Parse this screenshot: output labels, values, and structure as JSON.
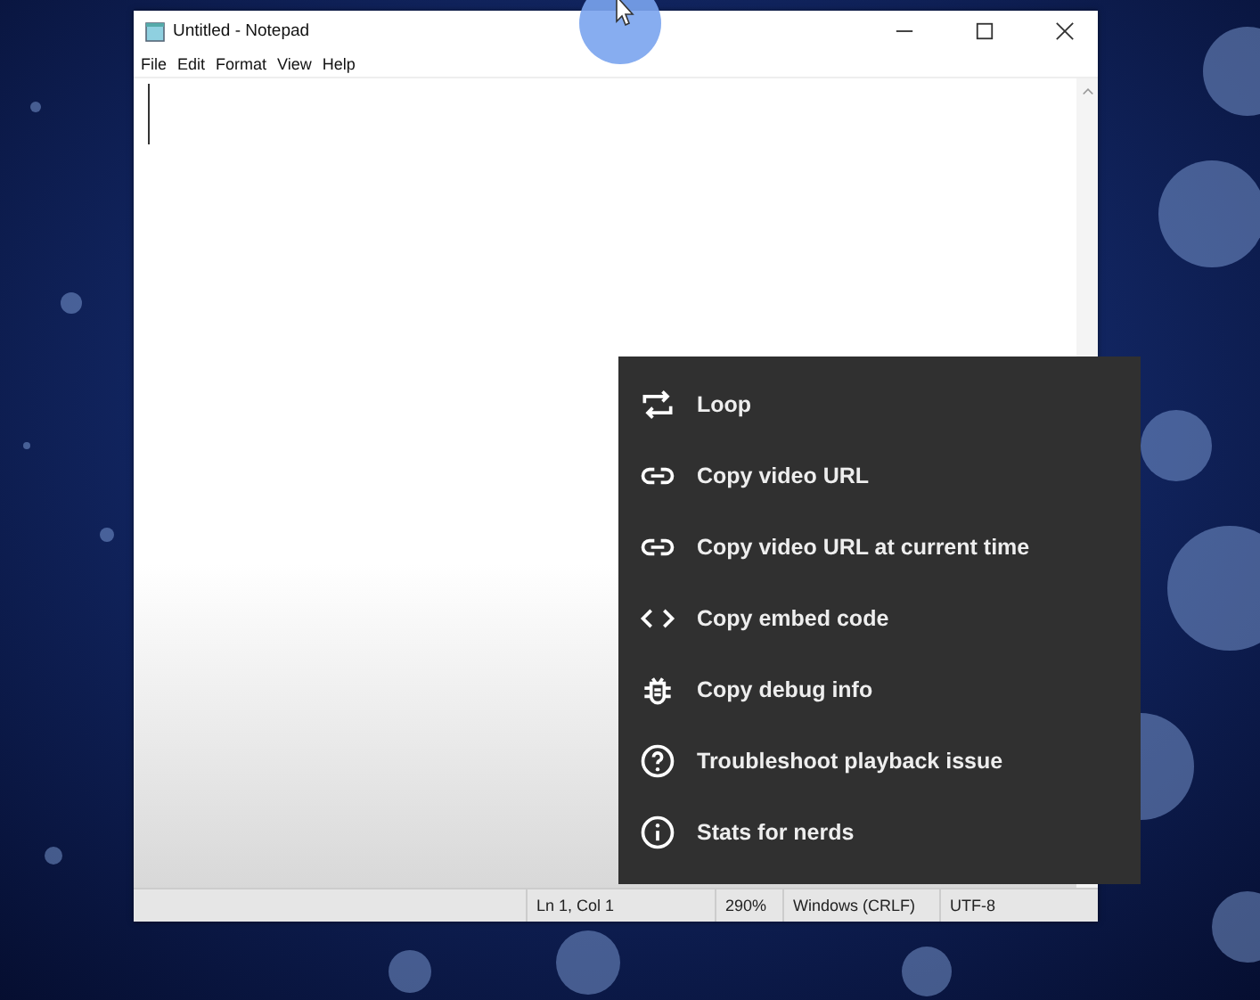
{
  "window": {
    "title": "Untitled - Notepad"
  },
  "menu_bar": [
    "File",
    "Edit",
    "Format",
    "View",
    "Help"
  ],
  "status_bar": [
    "Ln 1, Col 1",
    "290%",
    "Windows (CRLF)",
    "UTF-8"
  ],
  "context_menu": [
    {
      "kind": "loop",
      "label": "Loop"
    },
    {
      "kind": "link",
      "label": "Copy video URL"
    },
    {
      "kind": "link",
      "label": "Copy video URL at current time"
    },
    {
      "kind": "code",
      "label": "Copy embed code"
    },
    {
      "kind": "bug",
      "label": "Copy debug info"
    },
    {
      "kind": "help",
      "label": "Troubleshoot playback issue"
    },
    {
      "kind": "info",
      "label": "Stats for nerds"
    }
  ]
}
